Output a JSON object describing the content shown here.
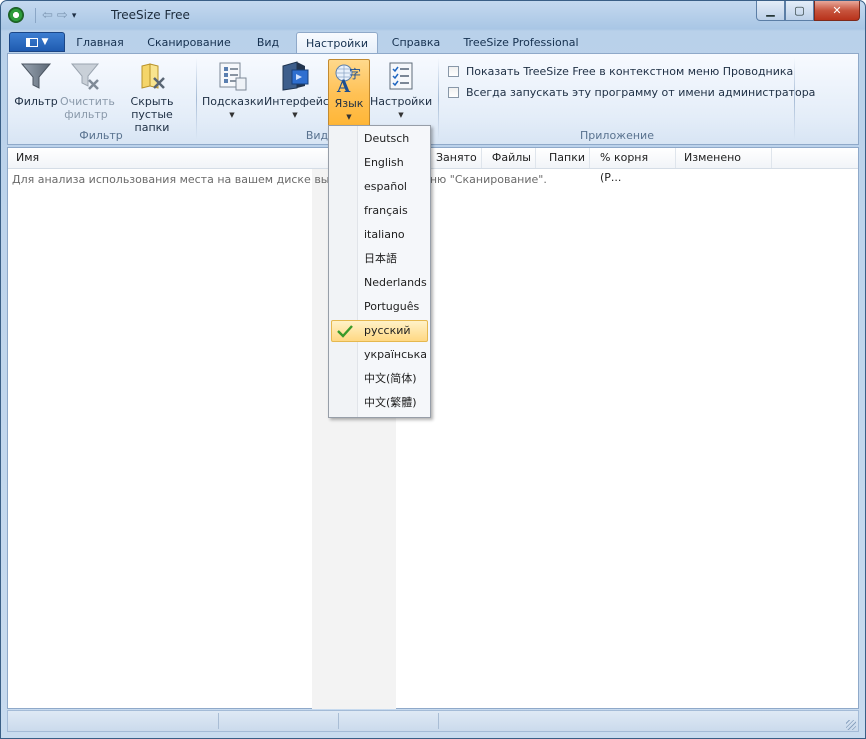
{
  "window": {
    "title": "TreeSize Free"
  },
  "tabs": [
    {
      "label": "Главная"
    },
    {
      "label": "Сканирование"
    },
    {
      "label": "Вид"
    },
    {
      "label": "Настройки"
    },
    {
      "label": "Справка"
    },
    {
      "label": "TreeSize Professional"
    }
  ],
  "ribbon": {
    "filter_group": {
      "label": "Фильтр",
      "filter_line1": "Фильтр",
      "clear_line1": "Очистить",
      "clear_line2": "фильтр",
      "hide_line1": "Скрыть",
      "hide_line2": "пустые папки"
    },
    "view_group": {
      "label": "Вид",
      "hints": "Подсказки",
      "interface": "Интерфейс",
      "language": "Язык",
      "settings": "Настройки"
    },
    "app_group": {
      "label": "Приложение",
      "check1": "Показать TreeSize Free в контекстном меню Проводника",
      "check2": "Всегда запускать эту программу от имени администратора"
    }
  },
  "columns": [
    {
      "label": "Имя"
    },
    {
      "label": "Занято"
    },
    {
      "label": "Файлы"
    },
    {
      "label": "Папки"
    },
    {
      "label": "% корня (Р..."
    },
    {
      "label": "Изменено"
    }
  ],
  "hint_text": "Для анализа использования места на вашем диске выберите диск в меню \"Сканирование\".",
  "language_menu": {
    "items": [
      {
        "label": "Deutsch"
      },
      {
        "label": "English"
      },
      {
        "label": "español"
      },
      {
        "label": "français"
      },
      {
        "label": "italiano"
      },
      {
        "label": "日本語"
      },
      {
        "label": "Nederlands"
      },
      {
        "label": "Português"
      },
      {
        "label": "русский"
      },
      {
        "label": "українська"
      },
      {
        "label": "中文(简体)"
      },
      {
        "label": "中文(繁體)"
      }
    ],
    "selected": "русский"
  },
  "colors": {
    "accent": "#1f5bb0",
    "highlight": "#ffc155",
    "check": "#3a9a2a"
  }
}
